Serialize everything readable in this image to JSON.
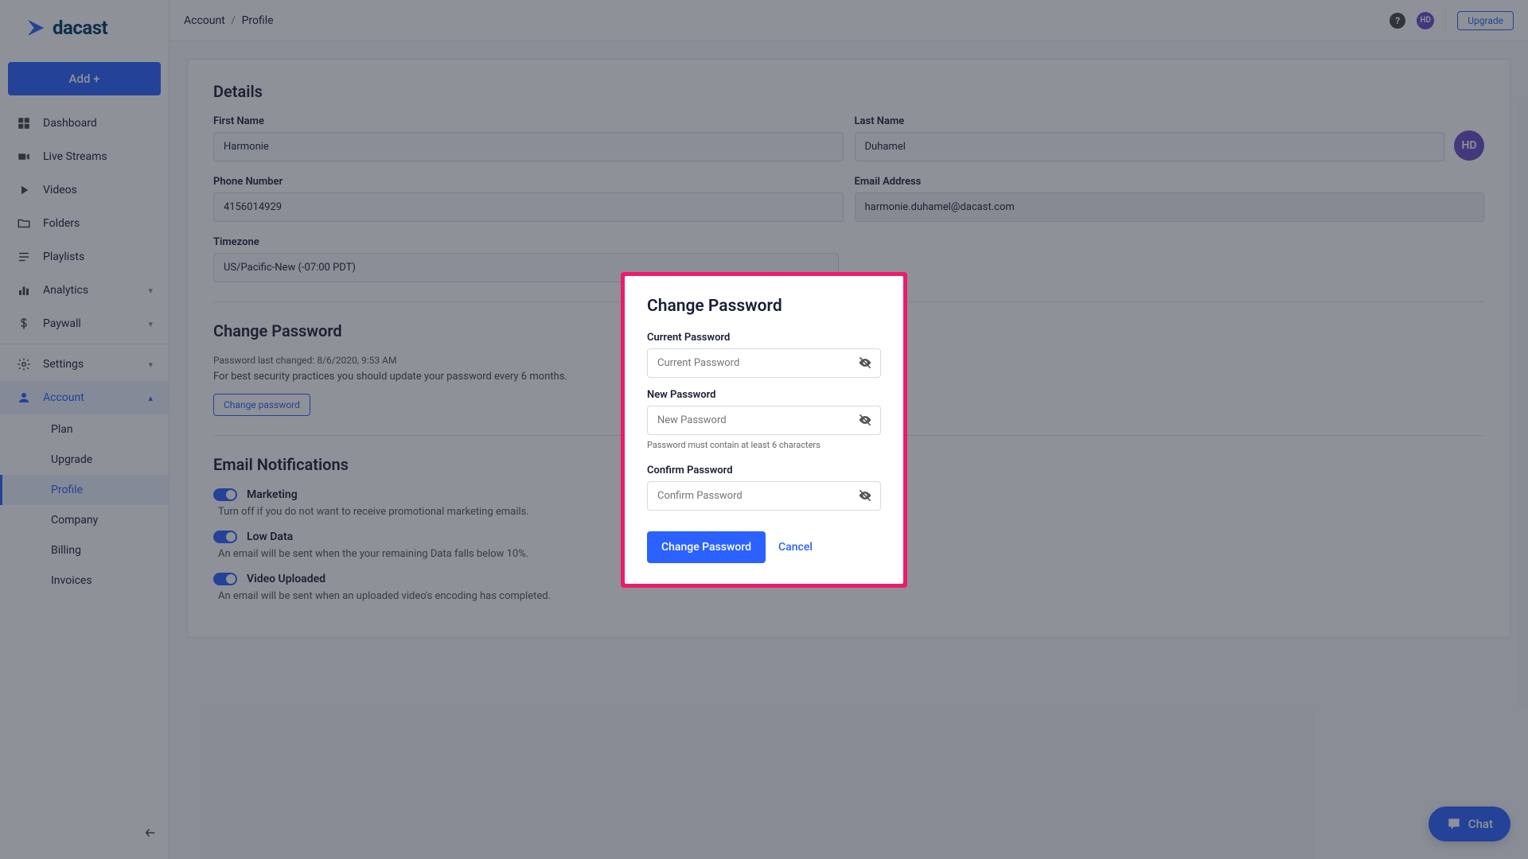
{
  "logo_text": "dacast",
  "add_button": "Add +",
  "nav": {
    "dashboard": "Dashboard",
    "live_streams": "Live Streams",
    "videos": "Videos",
    "folders": "Folders",
    "playlists": "Playlists",
    "analytics": "Analytics",
    "paywall": "Paywall",
    "settings": "Settings",
    "account": "Account",
    "sub": {
      "plan": "Plan",
      "upgrade": "Upgrade",
      "profile": "Profile",
      "company": "Company",
      "billing": "Billing",
      "invoices": "Invoices"
    }
  },
  "breadcrumb": {
    "account": "Account",
    "profile": "Profile"
  },
  "topbar": {
    "upgrade": "Upgrade",
    "initials": "HD"
  },
  "details": {
    "title": "Details",
    "first_name_label": "First Name",
    "first_name": "Harmonie",
    "last_name_label": "Last Name",
    "last_name": "Duhamel",
    "avatar_initials": "HD",
    "phone_label": "Phone Number",
    "phone": "4156014929",
    "email_label": "Email Address",
    "email": "harmonie.duhamel@dacast.com",
    "timezone_label": "Timezone",
    "timezone": "US/Pacific-New (-07:00 PDT)"
  },
  "change_pw": {
    "title": "Change Password",
    "last_changed": "Password last changed: 8/6/2020, 9:53 AM",
    "note": "For best security practices you should update your password every 6 months.",
    "button": "Change password"
  },
  "notifications": {
    "title": "Email Notifications",
    "marketing_label": "Marketing",
    "marketing_desc": "Turn off if you do not want to receive promotional marketing emails.",
    "lowdata_label": "Low Data",
    "lowdata_desc": "An email will be sent when the your remaining Data falls below 10%.",
    "video_label": "Video Uploaded",
    "video_desc": "An email will be sent when an uploaded video's encoding has completed."
  },
  "modal": {
    "title": "Change Password",
    "current_label": "Current Password",
    "current_placeholder": "Current Password",
    "new_label": "New Password",
    "new_placeholder": "New Password",
    "hint": "Password must contain at least 6 characters",
    "confirm_label": "Confirm Password",
    "confirm_placeholder": "Confirm Password",
    "submit": "Change Password",
    "cancel": "Cancel"
  },
  "chat": "Chat"
}
